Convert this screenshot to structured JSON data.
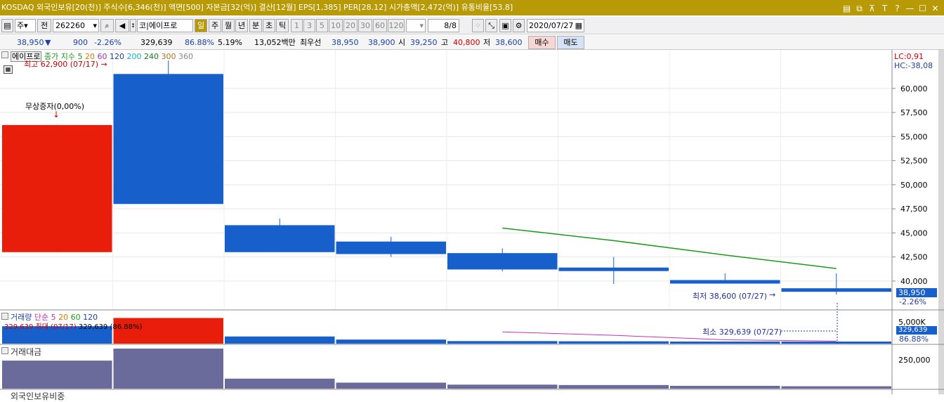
{
  "titlebar": {
    "text": "KOSDAQ 외국인보유[20(천)] 주식수[6,346(천)] 액면[500] 자본금[32(억)] 결산[12월] EPS[1,385] PER[28.12] 시가총액[2,472(억)] 유통비율[53.8]",
    "icons": [
      "layout-icon",
      "copy-icon",
      "pin-icon",
      "text-icon",
      "help-icon",
      "minimize-icon",
      "maximize-icon",
      "close-icon"
    ],
    "icon_glyphs": [
      "▤",
      "⧉",
      "⊼",
      "T",
      "?",
      "—",
      "☐",
      "✕"
    ]
  },
  "toolbar": {
    "market": "주",
    "market2": "전",
    "code": "262260",
    "name": "에이프로",
    "name_prefix": "코",
    "periods": [
      "일",
      "주",
      "월",
      "년",
      "분",
      "초",
      "틱"
    ],
    "intervals": [
      "1",
      "3",
      "5",
      "10",
      "20",
      "30",
      "60",
      "120"
    ],
    "page": "8/8",
    "date": "2020/07/27"
  },
  "quote": {
    "price": "38,950",
    "arrow": "▼",
    "change": "900",
    "change_pct": "-2.26%",
    "volume": "329,639",
    "vol_ratio": "86.88%",
    "turnover": "5.19%",
    "amount": "13,052백만",
    "best_label": "최우선",
    "best_ask": "38,950",
    "best_bid": "38,900",
    "open_label": "시",
    "open": "39,250",
    "high_label": "고",
    "high": "40,800",
    "low_label": "저",
    "low": "38,600",
    "buy": "매수",
    "sell": "매도"
  },
  "main_legend": {
    "name": "에이프로",
    "ma_label": "종가 지수",
    "ma": [
      "5",
      "20",
      "60",
      "120",
      "200",
      "240",
      "300",
      "360"
    ]
  },
  "annotations": {
    "high": "최고 62,900 (07/17) →",
    "bonus": "무상증자(0,00%)",
    "low": "최저 38,600 (07/27)",
    "lc": "LC:0,91",
    "hc": "HC:-38,08",
    "cur_price": "38,950",
    "cur_pct": "-2.26%"
  },
  "vol_legend": {
    "name": "거래량",
    "ma_label": "단순",
    "ma": [
      "5",
      "20",
      "60",
      "120"
    ],
    "max": "329,639 최대 (07/17)",
    "max_tail": "329,639 (86.88%)",
    "min": "최소 329,639 (07/27)",
    "cur": "329,639",
    "pct": "86.88%"
  },
  "amt_legend": {
    "name": "거래대금",
    "tick": "250,000"
  },
  "bottom_legend": "외국인보유비중",
  "colors": {
    "up": "#e81e0a",
    "down": "#1760cc",
    "ma5": "#1a9a1a",
    "ma20": "#cc2fb0",
    "amount": "#6b6b9b",
    "title": "#b89a06"
  },
  "chart_data": {
    "type": "candlestick",
    "y_ticks": [
      "60,000",
      "57,500",
      "55,000",
      "52,500",
      "50,000",
      "47,500",
      "45,000",
      "42,500",
      "40,000"
    ],
    "ylim": [
      37000,
      64000
    ],
    "candles": [
      {
        "open": 43000,
        "close": 56200,
        "high": 56200,
        "low": 43000,
        "up": true
      },
      {
        "open": 61500,
        "close": 48000,
        "high": 62900,
        "low": 48000,
        "up": false
      },
      {
        "open": 45800,
        "close": 43000,
        "high": 46500,
        "low": 43000,
        "up": false
      },
      {
        "open": 44100,
        "close": 42800,
        "high": 44600,
        "low": 42500,
        "up": false
      },
      {
        "open": 42900,
        "close": 41200,
        "high": 43400,
        "low": 41000,
        "up": false
      },
      {
        "open": 41400,
        "close": 41100,
        "high": 42500,
        "low": 39700,
        "up": false
      },
      {
        "open": 40100,
        "close": 39800,
        "high": 40800,
        "low": 39800,
        "up": false
      },
      {
        "open": 39250,
        "close": 38950,
        "high": 40800,
        "low": 38600,
        "up": false
      }
    ],
    "ma5": [
      null,
      null,
      null,
      null,
      45500,
      44200,
      42700,
      41300
    ],
    "volume_ticks": [
      "5,000K"
    ],
    "volume": [
      1700,
      2500,
      700,
      400,
      250,
      230,
      200,
      180
    ],
    "volume_ma": [
      null,
      null,
      null,
      null,
      1150,
      810,
      380,
      250
    ],
    "amount": [
      70,
      100,
      25,
      15,
      10,
      9,
      7,
      6
    ]
  }
}
